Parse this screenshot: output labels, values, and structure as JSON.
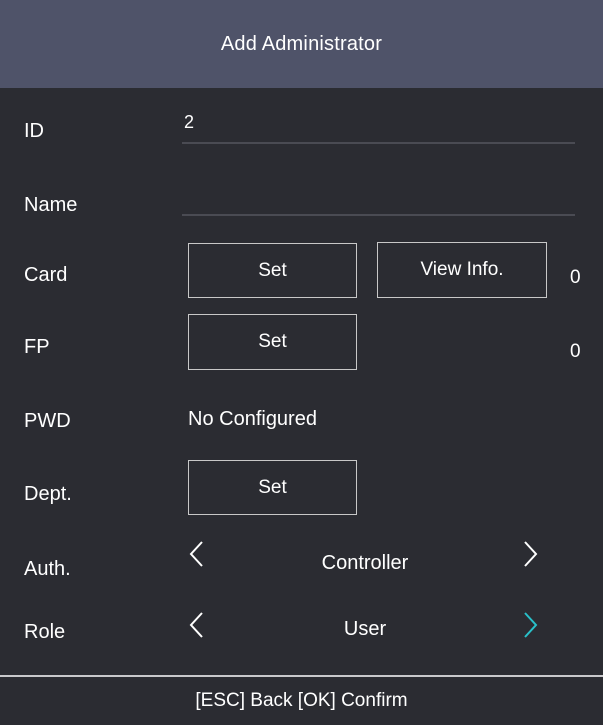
{
  "header": {
    "title": "Add Administrator"
  },
  "fields": {
    "id": {
      "label": "ID",
      "value": "2"
    },
    "name": {
      "label": "Name",
      "value": ""
    },
    "card": {
      "label": "Card",
      "set_label": "Set",
      "view_label": "View Info.",
      "count": "0"
    },
    "fp": {
      "label": "FP",
      "set_label": "Set",
      "count": "0"
    },
    "pwd": {
      "label": "PWD",
      "value": "No Configured"
    },
    "dept": {
      "label": "Dept.",
      "set_label": "Set"
    },
    "auth": {
      "label": "Auth.",
      "value": "Controller",
      "prev_icon": "chevron-left-icon",
      "next_icon": "chevron-right-icon"
    },
    "role": {
      "label": "Role",
      "value": "User",
      "prev_icon": "chevron-left-icon",
      "next_icon": "chevron-right-icon"
    }
  },
  "footer": {
    "hint": "[ESC] Back [OK] Confirm"
  },
  "colors": {
    "background": "#2b2c32",
    "header": "#4f5369",
    "accent": "#29c0c9",
    "text": "#ffffff"
  }
}
